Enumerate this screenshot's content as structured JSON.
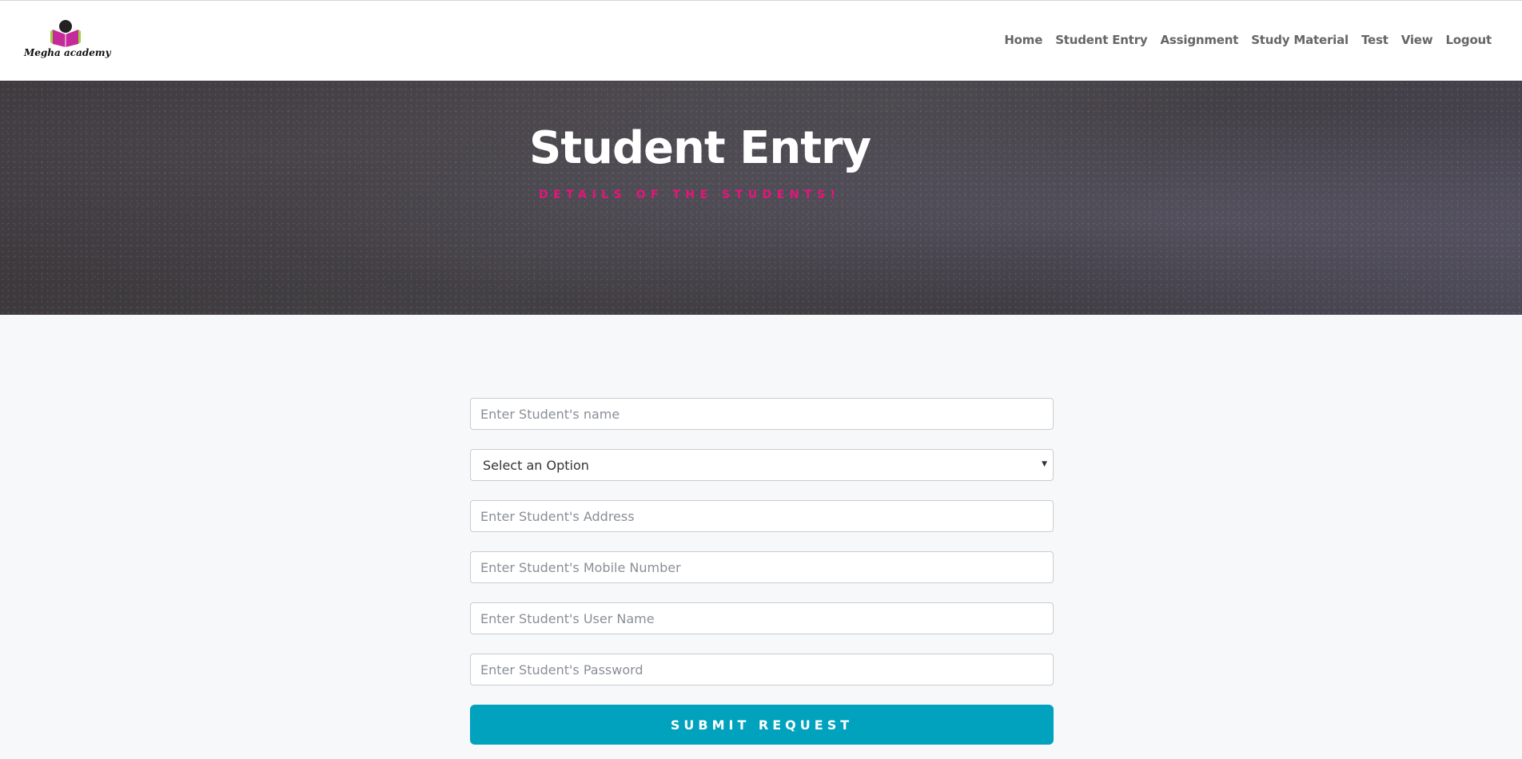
{
  "header": {
    "logo_text": "Megha academy",
    "nav": [
      {
        "label": "Home"
      },
      {
        "label": "Student Entry"
      },
      {
        "label": "Assignment"
      },
      {
        "label": "Study Material"
      },
      {
        "label": "Test"
      },
      {
        "label": "View"
      },
      {
        "label": "Logout"
      }
    ]
  },
  "hero": {
    "title": "Student Entry",
    "subtitle": "DETAILS OF THE STUDENTS!"
  },
  "form": {
    "name_placeholder": "Enter Student's name",
    "select_value": "Select an Option",
    "address_placeholder": "Enter Student's Address",
    "mobile_placeholder": "Enter Student's Mobile Number",
    "username_placeholder": "Enter Student's User Name",
    "password_placeholder": "Enter Student's Password",
    "submit_label": "SUBMIT REQUEST"
  },
  "colors": {
    "accent": "#00a2bd",
    "subtitle": "#e8137c",
    "logo_book": "#c42a9a"
  }
}
